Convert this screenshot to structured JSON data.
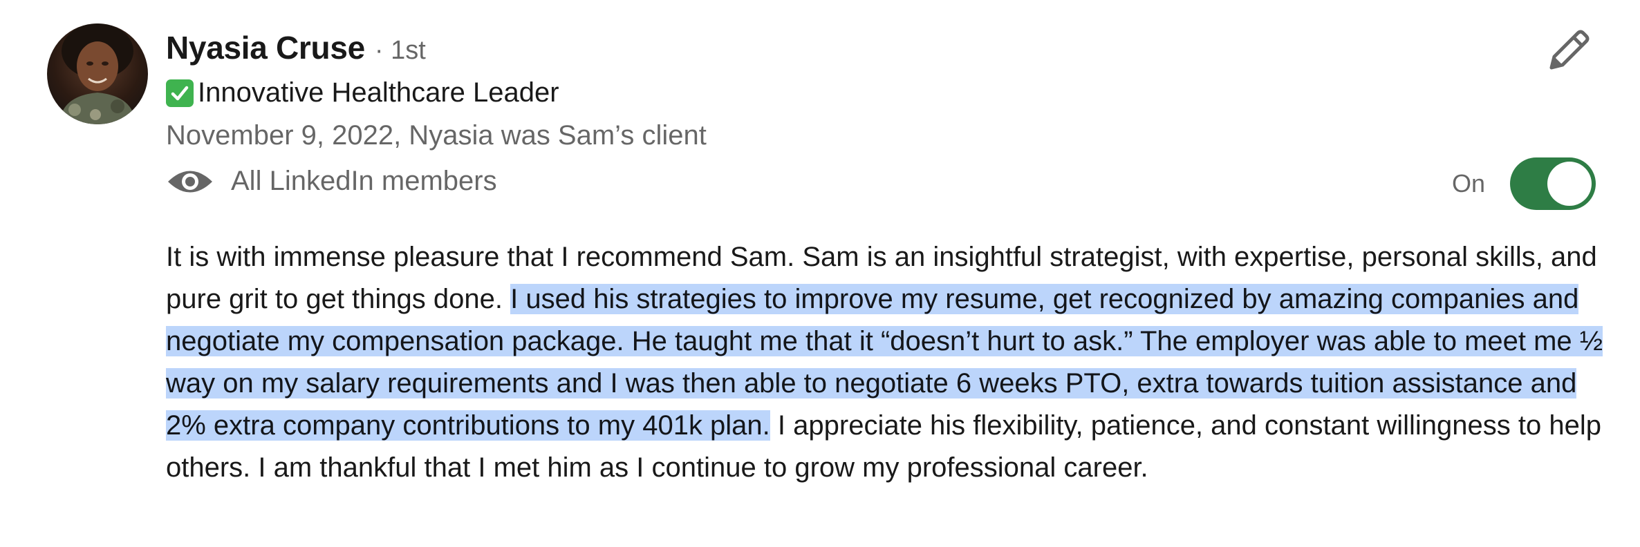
{
  "recommendation": {
    "author_name": "Nyasia Cruse",
    "connection_degree": "· 1st",
    "headline_emoji": "check-mark-button-emoji",
    "headline": "Innovative Healthcare Leader",
    "date_relationship": "November 9, 2022, Nyasia was Sam’s client",
    "visibility_label": "All LinkedIn members",
    "toggle_label": "On",
    "toggle_state": "on",
    "text_before_selection": "It is with immense pleasure that I recommend Sam. Sam is an insightful strategist, with expertise, personal skills, and pure grit to get things done. ",
    "text_selected": "I used his strategies to improve my resume, get recognized by amazing companies and negotiate my compensation package. He taught me that it “doesn’t hurt to ask.” The employer was able to meet me ½ way on my salary requirements and I was then able to negotiate 6 weeks PTO, extra towards tuition assistance and 2% extra company contributions to my 401k plan.",
    "text_after_selection": " I appreciate his flexibility, patience, and constant willingness to help others. I am thankful that I met him as I continue to grow my professional career."
  },
  "icons": {
    "edit": "pencil-icon",
    "visibility": "eye-icon"
  },
  "colors": {
    "toggle_on": "#2e7d45",
    "selection_highlight": "#bcd5fb",
    "check_green": "#3fb34f"
  }
}
